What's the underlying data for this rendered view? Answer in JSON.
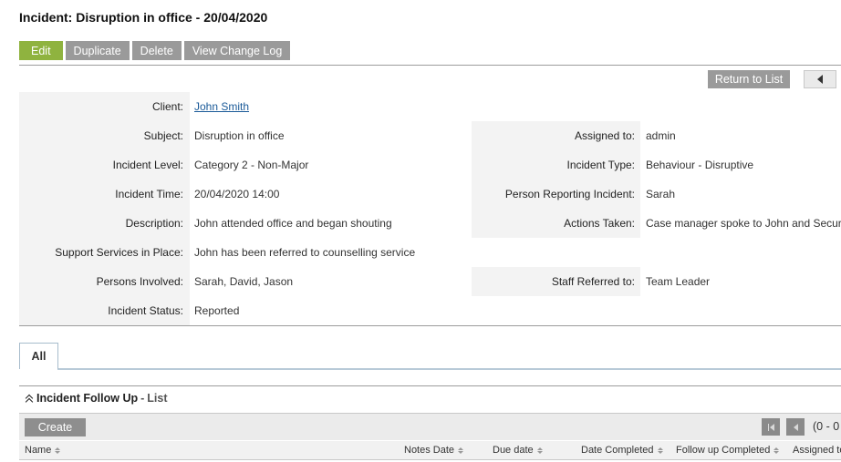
{
  "page": {
    "title": "Incident: Disruption in office - 20/04/2020"
  },
  "toolbar": {
    "edit": "Edit",
    "duplicate": "Duplicate",
    "delete": "Delete",
    "view_change_log": "View Change Log"
  },
  "nav": {
    "return_to_list": "Return to List",
    "prev_icon": "triangle-left-icon"
  },
  "details": {
    "client_label": "Client:",
    "client_value": "John Smith",
    "subject_label": "Subject:",
    "subject_value": "Disruption in office",
    "assigned_label": "Assigned to:",
    "assigned_value": "admin",
    "level_label": "Incident Level:",
    "level_value": "Category 2 - Non-Major",
    "type_label": "Incident Type:",
    "type_value": "Behaviour - Disruptive",
    "time_label": "Incident Time:",
    "time_value": "20/04/2020 14:00",
    "reporter_label": "Person Reporting Incident:",
    "reporter_value": "Sarah",
    "description_label": "Description:",
    "description_value": "John attended office and began shouting",
    "actions_label": "Actions Taken:",
    "actions_value": "Case manager spoke to John and Security",
    "support_label": "Support Services in Place:",
    "support_value": "John has been referred to counselling service",
    "persons_label": "Persons Involved:",
    "persons_value": "Sarah, David, Jason",
    "staff_label": "Staff Referred to:",
    "staff_value": "Team Leader",
    "status_label": "Incident Status:",
    "status_value": "Reported"
  },
  "tabs": [
    {
      "label": "All"
    }
  ],
  "followup": {
    "title": "Incident Follow Up",
    "separator": "-",
    "subtitle": "List",
    "create": "Create",
    "page_count": "(0 - 0",
    "columns": [
      "Name",
      "Notes Date",
      "Due date",
      "Date Completed",
      "Follow up Completed",
      "Assigned to"
    ]
  }
}
